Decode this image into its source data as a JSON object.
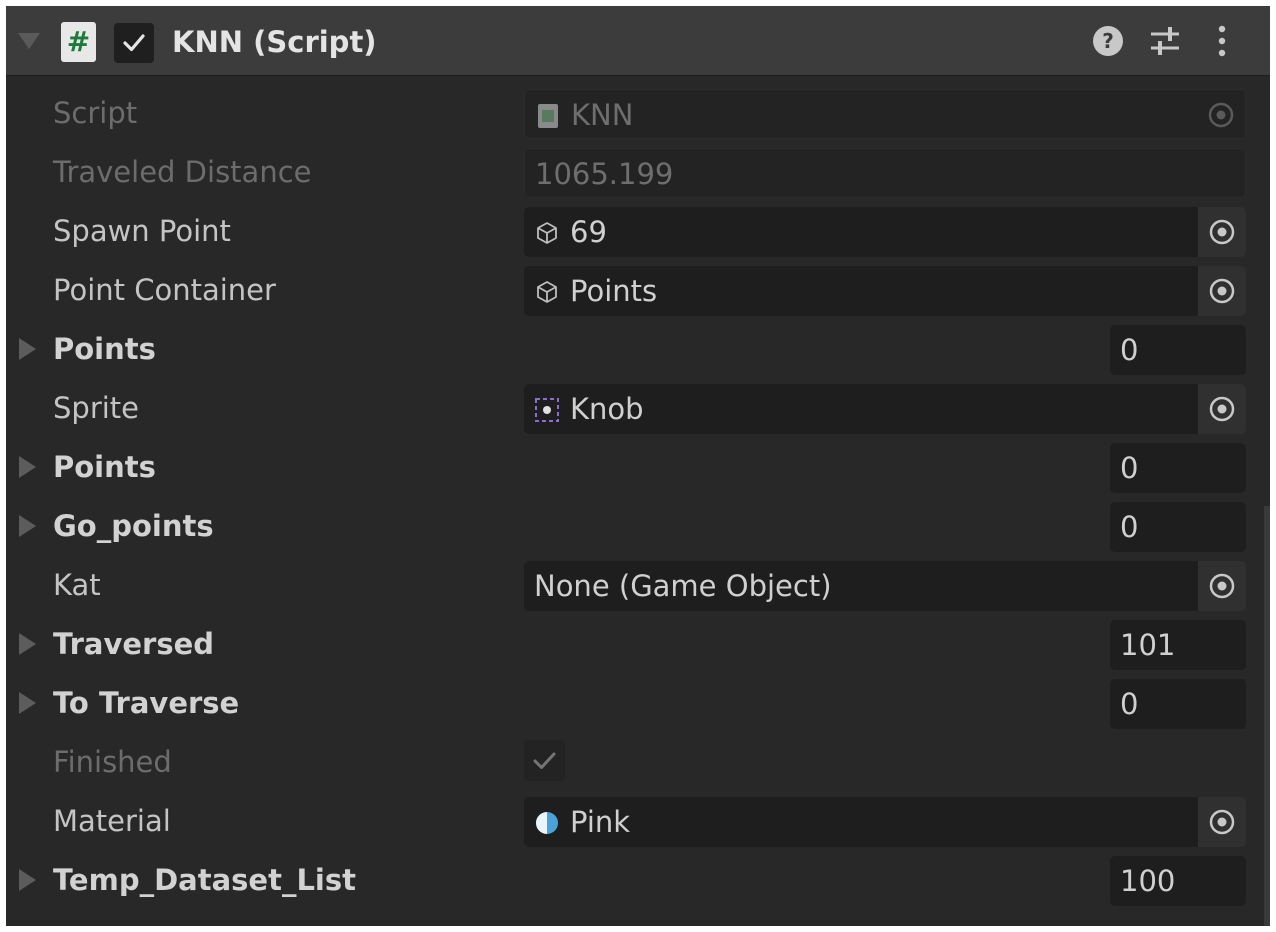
{
  "header": {
    "title": "KNN (Script)",
    "script_icon_glyph": "#",
    "enabled": true,
    "icons": [
      "help-icon",
      "presets-icon",
      "more-icon"
    ]
  },
  "fields": {
    "script": {
      "label": "Script",
      "value": "KNN"
    },
    "traveled_distance": {
      "label": "Traveled Distance",
      "value": "1065.199"
    },
    "spawn_point": {
      "label": "Spawn Point",
      "value": "69"
    },
    "point_container": {
      "label": "Point Container",
      "value": "Points"
    },
    "points_1": {
      "label": "Points",
      "size": "0"
    },
    "sprite": {
      "label": "Sprite",
      "value": "Knob"
    },
    "points_2": {
      "label": "Points",
      "size": "0"
    },
    "go_points": {
      "label": "Go_points",
      "size": "0"
    },
    "kat": {
      "label": "Kat",
      "value": "None (Game Object)"
    },
    "traversed": {
      "label": "Traversed",
      "size": "101"
    },
    "to_traverse": {
      "label": "To Traverse",
      "size": "0"
    },
    "finished": {
      "label": "Finished",
      "checked": true
    },
    "material": {
      "label": "Material",
      "value": "Pink"
    },
    "temp_dataset_list": {
      "label": "Temp_Dataset_List",
      "size": "100"
    }
  },
  "colors": {
    "panel_bg": "#282828",
    "header_bg": "#3c3c3c",
    "field_bg": "#1e1e1e",
    "text": "#c4c4c4",
    "disabled_text": "#6c6c6c",
    "script_icon_green": "#1d7a3a",
    "material_blue": "#4aa3d8",
    "sprite_purple": "#8a6fd0"
  }
}
